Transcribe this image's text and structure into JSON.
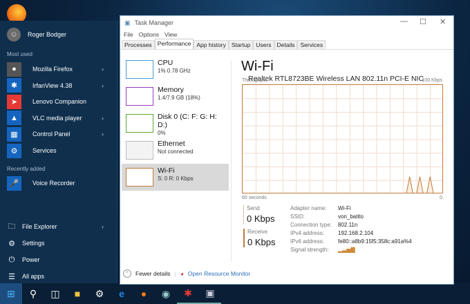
{
  "start_menu": {
    "user": "Roger Bodger",
    "most_used_label": "Most used",
    "apps": [
      {
        "label": "Mozilla Firefox",
        "icon": "firefox-icon",
        "has_arrow": true,
        "color": "#555555"
      },
      {
        "label": "IrfanView 4.38",
        "icon": "irfanview-icon",
        "has_arrow": true,
        "color": "#1565c0"
      },
      {
        "label": "Lenovo Companion",
        "icon": "lenovo-companion-icon",
        "has_arrow": false,
        "color": "#e53935"
      },
      {
        "label": "VLC media player",
        "icon": "vlc-icon",
        "has_arrow": true,
        "color": "#1565c0"
      },
      {
        "label": "Control Panel",
        "icon": "control-panel-icon",
        "has_arrow": true,
        "color": "#1565c0"
      },
      {
        "label": "Services",
        "icon": "services-icon",
        "has_arrow": false,
        "color": "#1565c0"
      }
    ],
    "recently_added_label": "Recently added",
    "recent": [
      {
        "label": "Voice Recorder",
        "icon": "voice-recorder-icon"
      }
    ],
    "bottom": [
      {
        "label": "File Explorer",
        "icon": "file-explorer-icon",
        "has_arrow": true
      },
      {
        "label": "Settings",
        "icon": "settings-icon"
      },
      {
        "label": "Power",
        "icon": "power-icon"
      },
      {
        "label": "All apps",
        "icon": "all-apps-icon"
      }
    ]
  },
  "taskbar": [
    "start",
    "search",
    "task-view",
    "file-explorer",
    "settings",
    "edge",
    "firefox",
    "media",
    "irfanview",
    "task-manager"
  ],
  "task_manager": {
    "title": "Task Manager",
    "menu": [
      "File",
      "Options",
      "View"
    ],
    "tabs": [
      "Processes",
      "Performance",
      "App history",
      "Startup",
      "Users",
      "Details",
      "Services"
    ],
    "active_tab": "Performance",
    "resources": [
      {
        "name": "CPU",
        "value": "1% 0.78 GHz",
        "color": "#4a9ad4"
      },
      {
        "name": "Memory",
        "value": "1.4/7.9 GB (18%)",
        "color": "#9b3bbf"
      },
      {
        "name": "Disk 0 (C: F: G: H: D:)",
        "value": "0%",
        "color": "#5aa832"
      },
      {
        "name": "Ethernet",
        "value": "Not connected",
        "color": "#bbbbbb"
      },
      {
        "name": "Wi-Fi",
        "value": "S: 0 R: 0 Kbps",
        "color": "#c17a3a",
        "selected": true
      }
    ],
    "main": {
      "title": "Wi-Fi",
      "adapter": "Realtek RTL8723BE Wireless LAN 802.11n PCI-E NIC",
      "graph_label": "Throughput",
      "graph_max": "100 Kbps",
      "graph_time": "60 seconds",
      "graph_min": "0",
      "receive_kbps_samples": [
        0,
        0,
        0,
        0,
        0,
        0,
        0,
        0,
        0,
        0,
        0,
        0,
        0,
        0,
        0,
        0,
        0,
        0,
        0,
        0,
        0,
        0,
        0,
        0,
        0,
        0,
        0,
        0,
        0,
        0,
        0,
        0,
        0,
        0,
        0,
        0,
        0,
        0,
        0,
        0,
        0,
        0,
        0,
        0,
        0,
        0,
        0,
        0,
        0,
        16,
        0,
        0,
        16,
        0,
        0,
        16,
        0,
        0,
        0,
        0
      ],
      "send_label": "Send",
      "send_value": "0 Kbps",
      "receive_label": "Receive",
      "receive_value": "0 Kbps",
      "details": [
        {
          "k": "Adapter name:",
          "v": "Wi-Fi"
        },
        {
          "k": "SSID:",
          "v": "von_batito"
        },
        {
          "k": "Connection type:",
          "v": "802.11n"
        },
        {
          "k": "IPv4 address:",
          "v": "192.168.2.104"
        },
        {
          "k": "IPv6 address:",
          "v": "fe80::a8b9:15f5:358c:a91a%4"
        },
        {
          "k": "Signal strength:",
          "v": ""
        }
      ],
      "signal_bars": 5
    },
    "footer": {
      "fewer": "Fewer details",
      "monitor": "Open Resource Monitor"
    }
  }
}
